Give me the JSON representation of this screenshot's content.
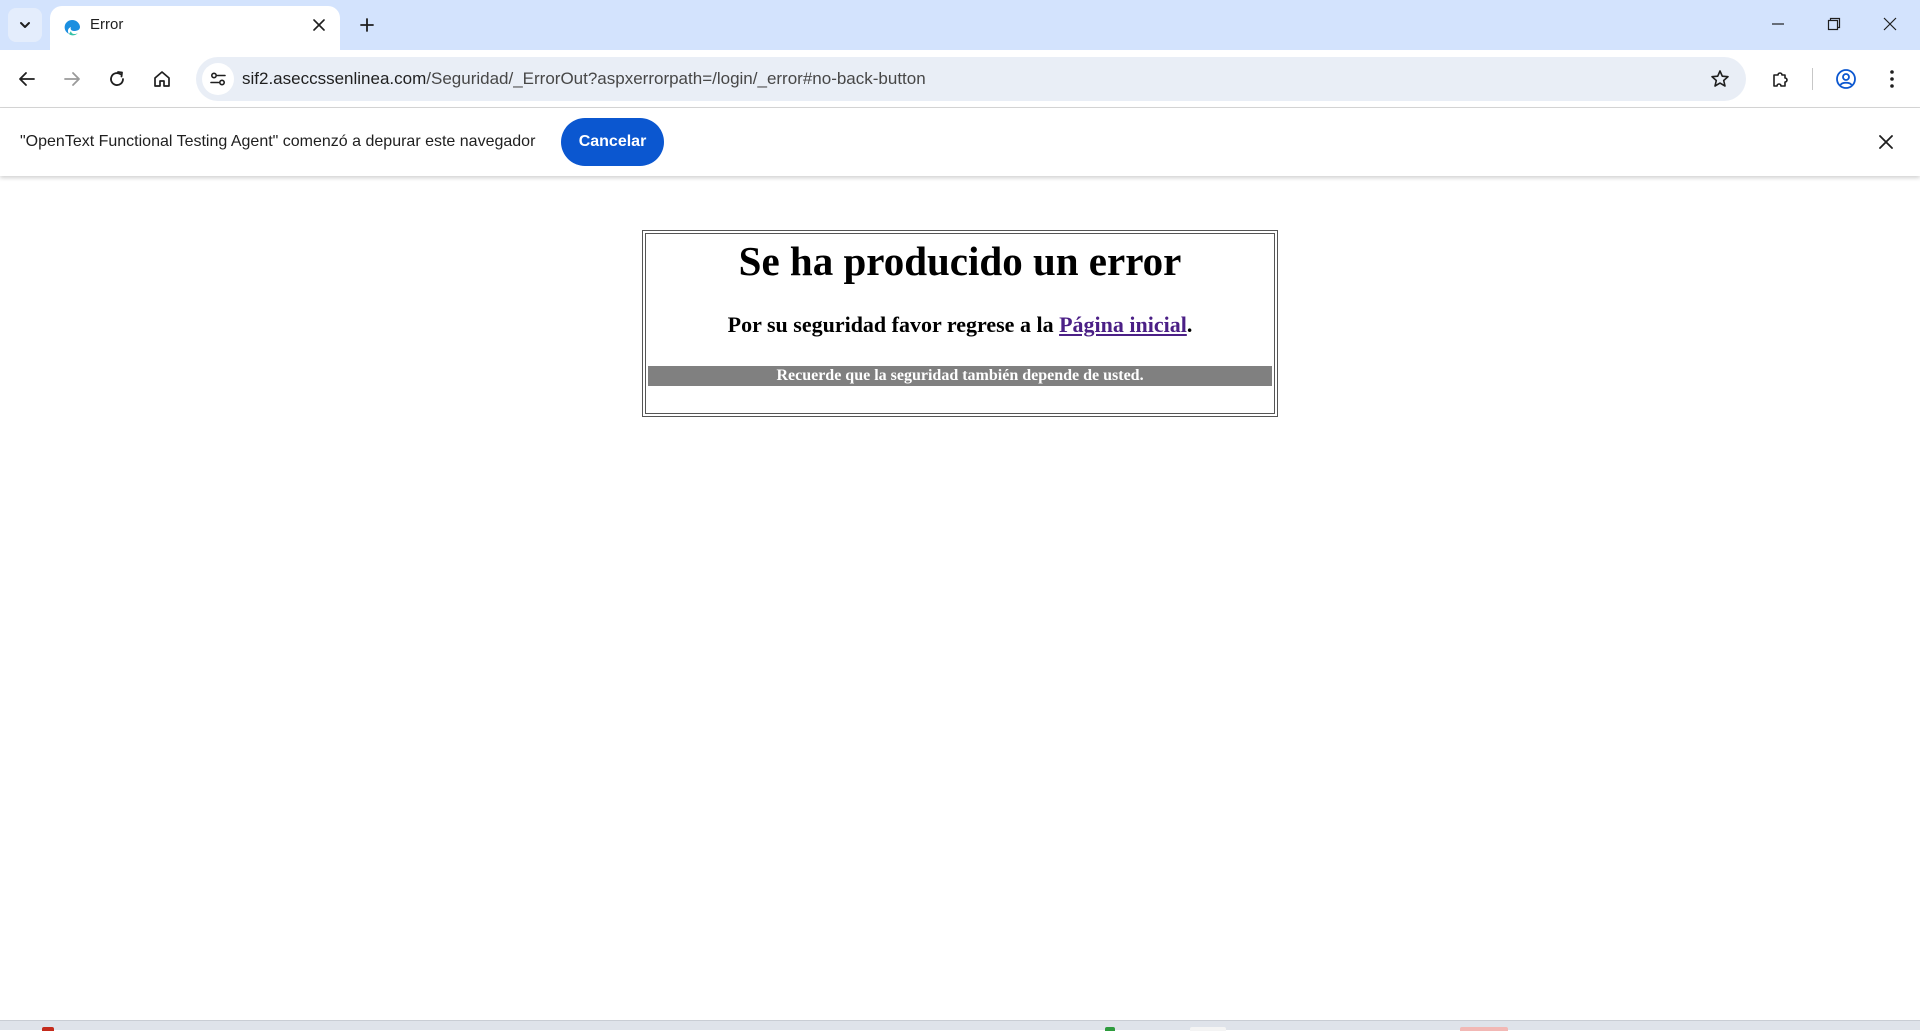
{
  "browser": {
    "tab": {
      "title": "Error"
    },
    "address_bar": {
      "url_host": "sif2.aseccssenlinea.com",
      "url_path": "/Seguridad/_ErrorOut?aspxerrorpath=/login/_error#no-back-button"
    },
    "icons": {
      "tab_search": "chevron-down-icon",
      "favicon": "edge-favicon-icon",
      "tab_close": "close-icon",
      "new_tab": "plus-icon",
      "minimize": "minimize-icon",
      "restore": "restore-icon",
      "close_window": "close-icon",
      "back": "arrow-left-icon",
      "forward": "arrow-right-icon",
      "reload": "reload-icon",
      "home": "home-icon",
      "site_info": "tune-icon",
      "bookmark": "star-icon",
      "extensions": "puzzle-icon",
      "profile": "profile-icon",
      "menu": "kebab-menu-icon"
    }
  },
  "infobar": {
    "message": "\"OpenText Functional Testing Agent\" comenzó a depurar este navegador",
    "cancel_label": "Cancelar"
  },
  "page": {
    "title": "Se ha producido un error",
    "message_prefix": "Por su seguridad favor regrese a la ",
    "link_label": "Página inicial",
    "message_suffix": ".",
    "reminder": "Recuerde que la seguridad también depende de usted."
  },
  "colors": {
    "tabstrip_bg": "#d3e3fd",
    "omnibox_bg": "#e9eef6",
    "accent_button": "#0b57d0",
    "visited_link": "#4b1f86",
    "reminder_bar": "#808080"
  }
}
